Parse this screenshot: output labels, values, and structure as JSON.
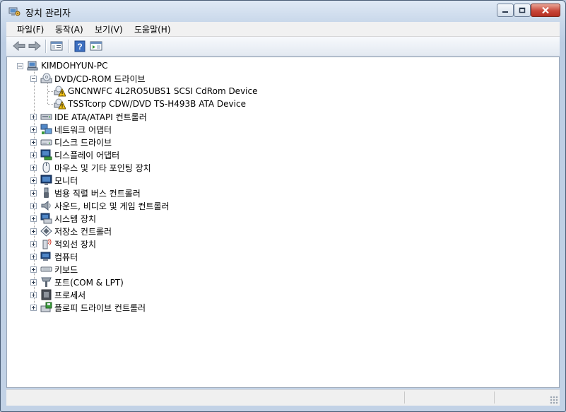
{
  "window": {
    "title": "장치 관리자"
  },
  "menu": [
    "파일(F)",
    "동작(A)",
    "보기(V)",
    "도움말(H)"
  ],
  "toolbar": {
    "icons": [
      "back-arrow-icon",
      "forward-arrow-icon",
      "properties-window-icon",
      "help-icon",
      "console-tree-icon"
    ]
  },
  "tree": {
    "root": {
      "label": "KIMDOHYUN-PC",
      "icon": "computer-icon"
    },
    "expanded": {
      "label": "DVD/CD-ROM 드라이브",
      "icon": "dvd-drive-icon",
      "children": [
        {
          "label": "GNCNWFC 4L2RO5UBS1 SCSI CdRom Device",
          "icon": "warning-drive-icon"
        },
        {
          "label": "TSSTcorp CDW/DVD TS-H493B ATA Device",
          "icon": "warning-drive-icon"
        }
      ]
    },
    "categories": [
      {
        "label": "IDE ATA/ATAPI 컨트롤러",
        "icon": "ide-controller-icon"
      },
      {
        "label": "네트워크 어댑터",
        "icon": "network-adapter-icon"
      },
      {
        "label": "디스크 드라이브",
        "icon": "disk-drive-icon"
      },
      {
        "label": "디스플레이 어댑터",
        "icon": "display-adapter-icon"
      },
      {
        "label": "마우스 및 기타 포인팅 장치",
        "icon": "mouse-icon"
      },
      {
        "label": "모니터",
        "icon": "monitor-icon"
      },
      {
        "label": "범용 직렬 버스 컨트롤러",
        "icon": "usb-icon"
      },
      {
        "label": "사운드, 비디오 및 게임 컨트롤러",
        "icon": "speaker-icon"
      },
      {
        "label": "시스템 장치",
        "icon": "system-device-icon"
      },
      {
        "label": "저장소 컨트롤러",
        "icon": "storage-controller-icon"
      },
      {
        "label": "적외선 장치",
        "icon": "infrared-icon"
      },
      {
        "label": "컴퓨터",
        "icon": "computer-category-icon"
      },
      {
        "label": "키보드",
        "icon": "keyboard-icon"
      },
      {
        "label": "포트(COM & LPT)",
        "icon": "port-icon"
      },
      {
        "label": "프로세서",
        "icon": "processor-icon"
      },
      {
        "label": "플로피 드라이브 컨트롤러",
        "icon": "floppy-controller-icon"
      }
    ]
  }
}
